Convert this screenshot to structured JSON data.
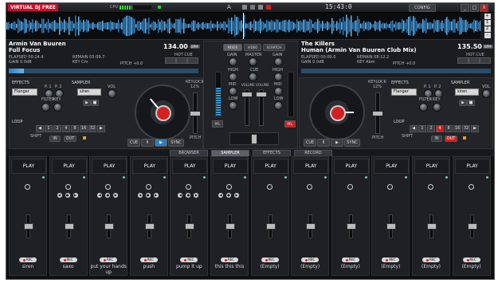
{
  "app": {
    "logo_brand": "VIRTUAL",
    "logo_product": "DJ FREE",
    "cpu_label": "CPU",
    "cpu_load": 0.4,
    "clock": "15:43:0",
    "config_label": "CONFIG",
    "minimize": "_",
    "maximize": "□",
    "close": "X"
  },
  "overview_zoom": {
    "plus": "+",
    "zoom_a": "1",
    "zoom_b": "2",
    "zoom_c": "3",
    "minus": "-"
  },
  "deck_left": {
    "artist": "Armin Van Buuren",
    "title": "Full Focus",
    "bpm": "134.00",
    "bpm_tag": "BPM",
    "elapsed": "ELAPSED 00:24.4",
    "remain": "REMAIN 05:09.7",
    "gain": "GAIN 0.0dB",
    "key": "KEY Cm",
    "pitch": "PITCH +0.0",
    "hotcue_label": "HOT CUE",
    "hotcues": [
      "1",
      "2",
      "3"
    ],
    "position": 0.08,
    "effects_label": "EFFECTS",
    "effect_value": "Flanger",
    "p1": "P. 1",
    "p2": "P. 2",
    "sampler_label": "SAMPLER",
    "sampler_value": "siren",
    "vol": "VOL",
    "filter_label": "FILTER",
    "key_label": "KEY",
    "loop_label": "LOOP",
    "shift_label": "SHIFT",
    "loop_sizes": [
      "1",
      "2",
      "4",
      "8",
      "16",
      "32"
    ],
    "loop_in": "IN",
    "loop_out": "OUT",
    "cue": "CUE",
    "pause": "II",
    "play": "▶",
    "sync": "SYNC",
    "keylock": "KEYLOCK",
    "keylock_pct": "12%",
    "pitch_label": "PITCH"
  },
  "deck_right": {
    "artist": "The Killers",
    "title": "Human (Armin Van Buuren Club Mix)",
    "bpm": "135.50",
    "bpm_tag": "BPM",
    "elapsed": "ELAPSED 00:00.0",
    "remain": "REMAIN 08:12.2",
    "gain": "GAIN 0.0dB",
    "key": "KEY Abm",
    "pitch": "PITCH +0.0",
    "hotcue_label": "HOT CUE",
    "hotcues": [
      "1",
      "2",
      "3"
    ],
    "position": 0.0,
    "effects_label": "EFFECTS",
    "effect_value": "Flanger",
    "p1": "P. 1",
    "p2": "P. 2",
    "sampler_label": "SAMPLER",
    "sampler_value": "siren",
    "vol": "VOL",
    "filter_label": "FILTER",
    "key_label": "KEY",
    "loop_label": "LOOP",
    "shift_label": "SHIFT",
    "loop_sizes": [
      "1",
      "2",
      "4",
      "8",
      "16",
      "32"
    ],
    "loop_in": "IN",
    "loop_out": "OUT",
    "cue": "CUE",
    "pause": "II",
    "play": "▶",
    "sync": "SYNC",
    "keylock": "KEYLOCK",
    "keylock_pct": "12%",
    "pitch_label": "PITCH"
  },
  "mixer": {
    "mixer_btn": "MIXER",
    "video_btn": "VIDEO",
    "scratch_btn": "SCRATCH",
    "gain": "GAIN",
    "master": "MASTER",
    "high": "HIGH",
    "mid": "MID",
    "low": "LOW",
    "cue": "CUE",
    "volume": "VOLUME",
    "pfl": "PFL"
  },
  "tabs": [
    "BROWSER",
    "SAMPLER",
    "EFFECTS",
    "RECORD"
  ],
  "active_tab": "SAMPLER",
  "sampler": {
    "play_label": "PLAY",
    "rec_label": "REC",
    "slots": [
      {
        "name": "siren",
        "controls": false
      },
      {
        "name": "saxo",
        "controls": true
      },
      {
        "name": "put your hands up",
        "controls": true
      },
      {
        "name": "push",
        "controls": true
      },
      {
        "name": "pump it up",
        "controls": true
      },
      {
        "name": "this this this",
        "controls": true
      },
      {
        "name": "(Empty)",
        "controls": false
      },
      {
        "name": "(Empty)",
        "controls": false
      },
      {
        "name": "(Empty)",
        "controls": false
      },
      {
        "name": "(Empty)",
        "controls": false
      },
      {
        "name": "(Empty)",
        "controls": false
      },
      {
        "name": "(Empty)",
        "controls": false
      }
    ]
  },
  "colors": {
    "accent_red": "#d42020",
    "wave_blue": "#2c7fc0",
    "vu_green": "#3ddc3d"
  }
}
